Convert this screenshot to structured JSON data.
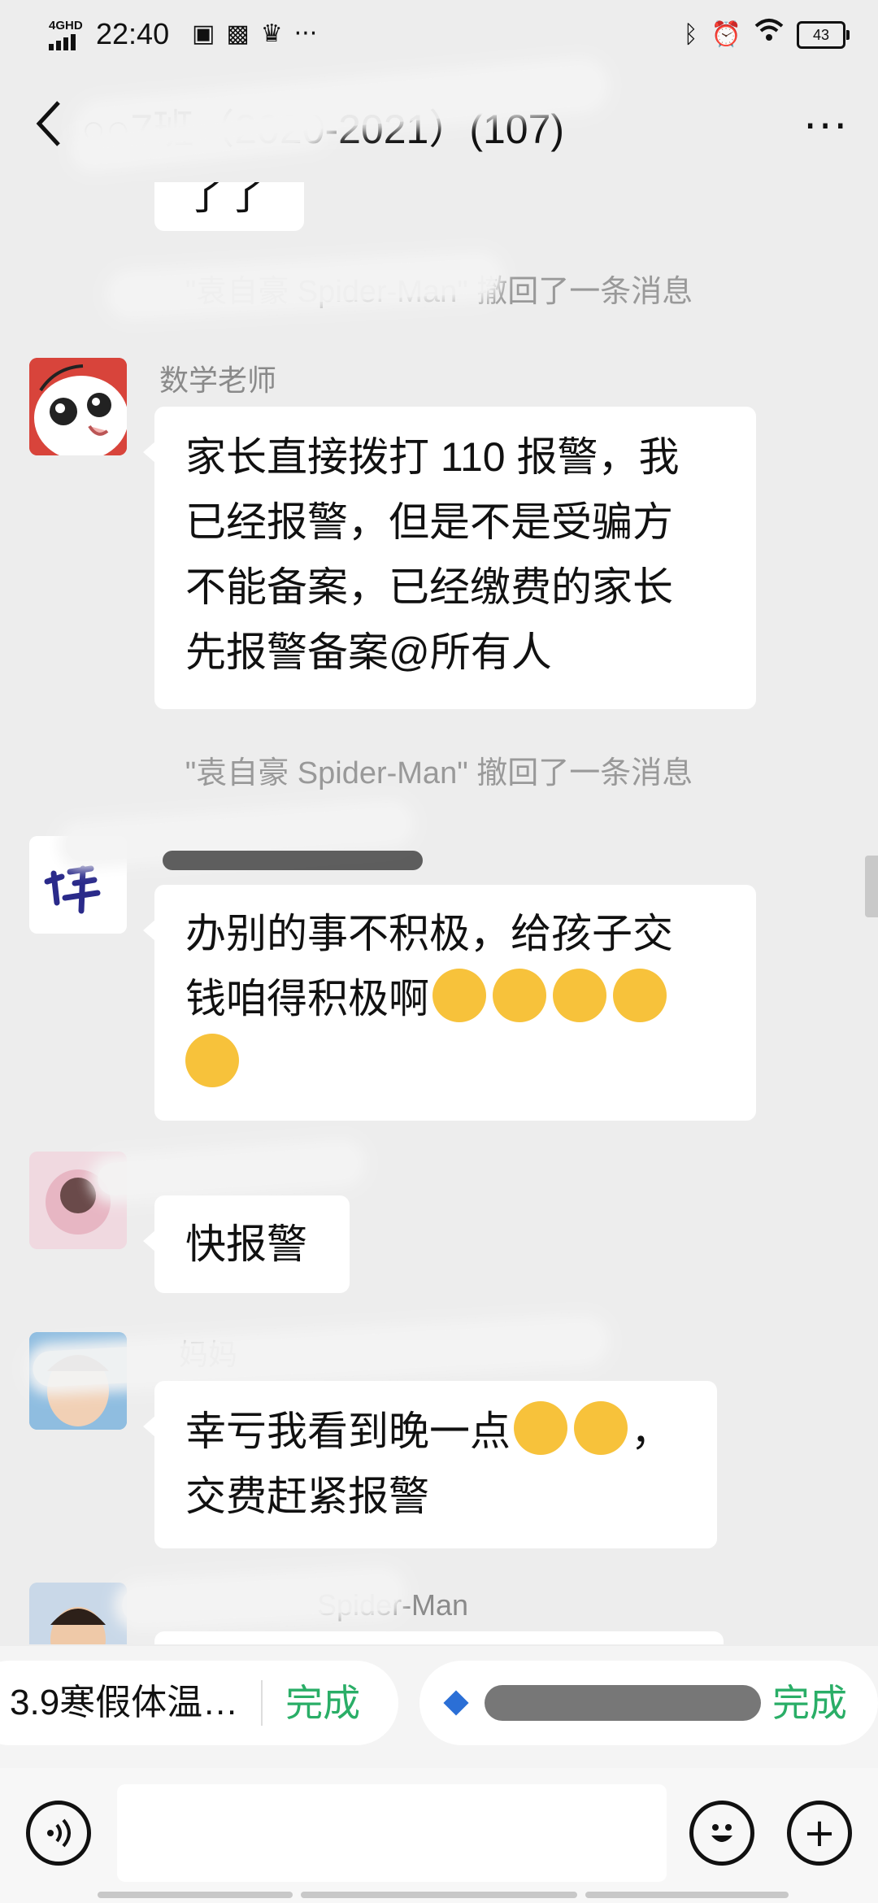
{
  "status_bar": {
    "network": "4GHD",
    "time": "22:40",
    "icons": [
      "badge-icon",
      "app-icon",
      "crown-icon",
      "more-dots-icon"
    ],
    "dots": "···",
    "right_icons": [
      "bluetooth-icon",
      "alarm-icon",
      "wifi-icon"
    ],
    "battery": "43"
  },
  "header": {
    "title": "○○7班（2020-2021）(107)",
    "more": "···"
  },
  "messages": {
    "prev_fragment": "了了",
    "recall_1": "\"袁自豪 Spider-Man\" 撤回了一条消息",
    "teacher": {
      "sender": "数学老师",
      "lines": [
        "家长直接拨打 110 报警，我",
        "已经报警，但是不是受骗方",
        "不能备案，已经缴费的家长",
        "先报警备案@所有人"
      ]
    },
    "recall_2": "\"袁自豪 Spider-Man\" 撤回了一条消息",
    "msg3": {
      "line1": "办别的事不积极，给孩子交",
      "line2": "钱咱得积极啊",
      "emoji": "face-with-tears-emoji"
    },
    "msg4": {
      "text": "快报警"
    },
    "msg5": {
      "sender_visible": "妈妈",
      "line1": "幸亏我看到晚一点",
      "line1_end": "，",
      "line2": "交费赶紧报警",
      "emoji": "tears-of-joy-emoji"
    },
    "msg6": {
      "sender_visible": "Spider-Man"
    }
  },
  "mini_programs": [
    {
      "label": "3.9寒假体温…",
      "action": "完成"
    },
    {
      "label": "",
      "action": "完成"
    }
  ],
  "input_bar": {
    "voice_icon": "voice-icon",
    "emoji_icon": "smiley-icon",
    "plus_icon": "plus-icon"
  },
  "colors": {
    "background": "#ededed",
    "bubble": "#ffffff",
    "accent_green": "#2aae67",
    "system_text": "#999999"
  }
}
